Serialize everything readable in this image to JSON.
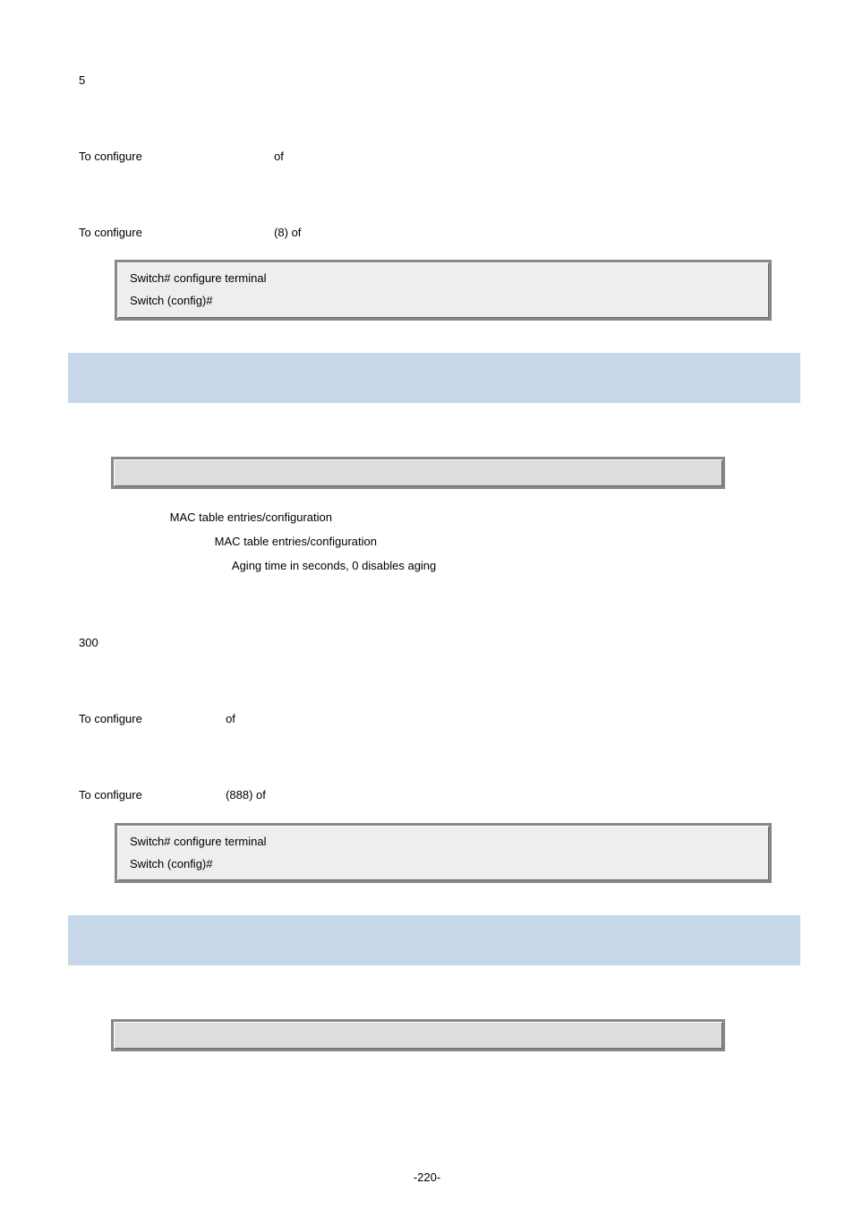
{
  "top": {
    "value": "5",
    "usage_line": [
      "To configure",
      "of"
    ],
    "example_line": [
      "To configure",
      "(8) of"
    ],
    "code": [
      "Switch# configure terminal",
      "Switch (config)#"
    ]
  },
  "section1": {
    "params": [
      "MAC table entries/configuration",
      "MAC table entries/configuration",
      "Aging time in seconds, 0 disables aging"
    ],
    "default": "300",
    "usage_line": [
      "To configure",
      "of"
    ],
    "example_line": [
      "To configure",
      "(888) of"
    ],
    "code": [
      "Switch# configure terminal",
      "Switch (config)#"
    ]
  },
  "footer": "-220-"
}
